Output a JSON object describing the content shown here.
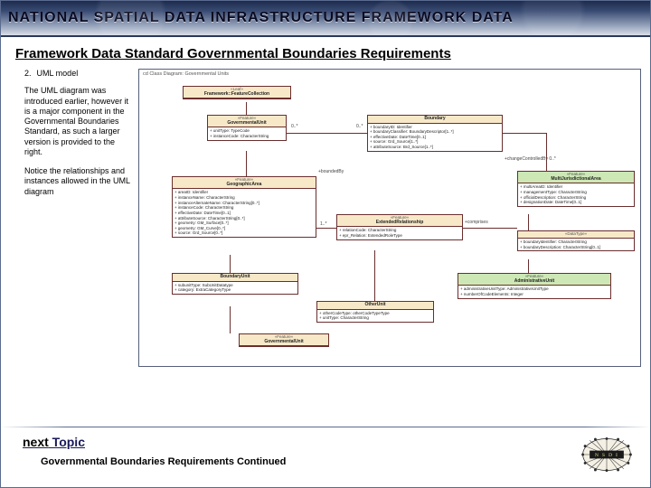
{
  "banner": {
    "title": "NATIONAL SPATIAL DATA INFRASTRUCTURE FRAMEWORK DATA"
  },
  "page": {
    "title": "Framework Data Standard Governmental Boundaries  Requirements"
  },
  "side": {
    "num": "2.",
    "heading": "UML model",
    "para1": "The UML diagram was introduced earlier, however it is a major component in the Governmental Boundaries Standard, as such a larger version is provided to the right.",
    "para2": "Notice the relationships and instances allowed in the UML diagram"
  },
  "diagram": {
    "title": "cd Class Diagram: Governmental Units",
    "classes": {
      "fw": {
        "stereo": "«Leaf»",
        "name": "Framework::FeatureCollection"
      },
      "gu": {
        "stereo": "«Feature»",
        "name": "GovernmentalUnit",
        "attrs": "+ unitType: TypeCode\n+ instanceCode: CharacterString"
      },
      "bnd": {
        "stereo": "",
        "name": "Boundary",
        "attrs": "+ boundaryID: Identifier\n+ boundaryClassifier: BoundaryDescriptor[1..*]\n+ effectiveDate: DateTime[0..1]\n+ source: Grd_Source[1..*]\n+ attributeSource: Brd_Source[1..*]"
      },
      "ga": {
        "stereo": "«Feature»",
        "name": "GeographicArea",
        "attrs": "+ areaID: Identifier\n+ instanceName: CharacterString\n+ instanceAlternateName: CharacterString[0..*]\n+ instanceCode: CharacterString\n+ effectiveDate: DateTime[0..1]\n+ attributeSource: CharacterString[0..*]\n+ geometry: GM_Surface[0..*]\n+ geometry: GM_Curve[0..*]\n+ source: Grd_Source[0..*]"
      },
      "mau": {
        "stereo": "«Feature»",
        "name": "MultiJurisdictionalArea",
        "attrs": "+ multiAreaID: Identifier\n+ managementType: CharacterString\n+ officialDescription: CharacterString\n+ designationDate: DateTime[0..1]"
      },
      "epr": {
        "stereo": "«Feature»",
        "name": "ExtendedRelationship",
        "attrs": "+ relationCode: CharacterString\n+ epr_Relation: ExtendedRoleType"
      },
      "adm": {
        "stereo": "«Feature»",
        "name": "AdministrativeUnit",
        "attrs": "+ administrativeUnitType: AdministrativeUnitType\n+ numberOfCodeElements: Integer"
      },
      "bdy": {
        "stereo": "",
        "name": "BoundaryUnit",
        "attrs": "+ subunitType: SubUnitDatatype\n+ category: ExtraCategoryType"
      },
      "oth": {
        "stereo": "",
        "name": "OtherUnit",
        "attrs": "+ otherCodeType: otherCodeTypeType\n+ unitType: CharacterString"
      },
      "govu": {
        "stereo": "«Feature»",
        "name": "GovernmentalUnit"
      },
      "bdt": {
        "stereo": "«DataType»",
        "name": "",
        "attrs": "+ boundaryIdentifier: CharacterString\n+ boundaryDescription: CharacterString[0..1]"
      }
    },
    "mults": {
      "m1": "0..*",
      "m2": "+changeControlledBy  0..*",
      "m3": "0..*",
      "m4": "+boundedBy",
      "m5": "1..*",
      "m6": "+comprises"
    }
  },
  "footer": {
    "next_label_prefix": "next",
    "next_label_word": " Topic",
    "subtitle": "Governmental Boundaries Requirements Continued",
    "logo_text": "N S D I"
  }
}
